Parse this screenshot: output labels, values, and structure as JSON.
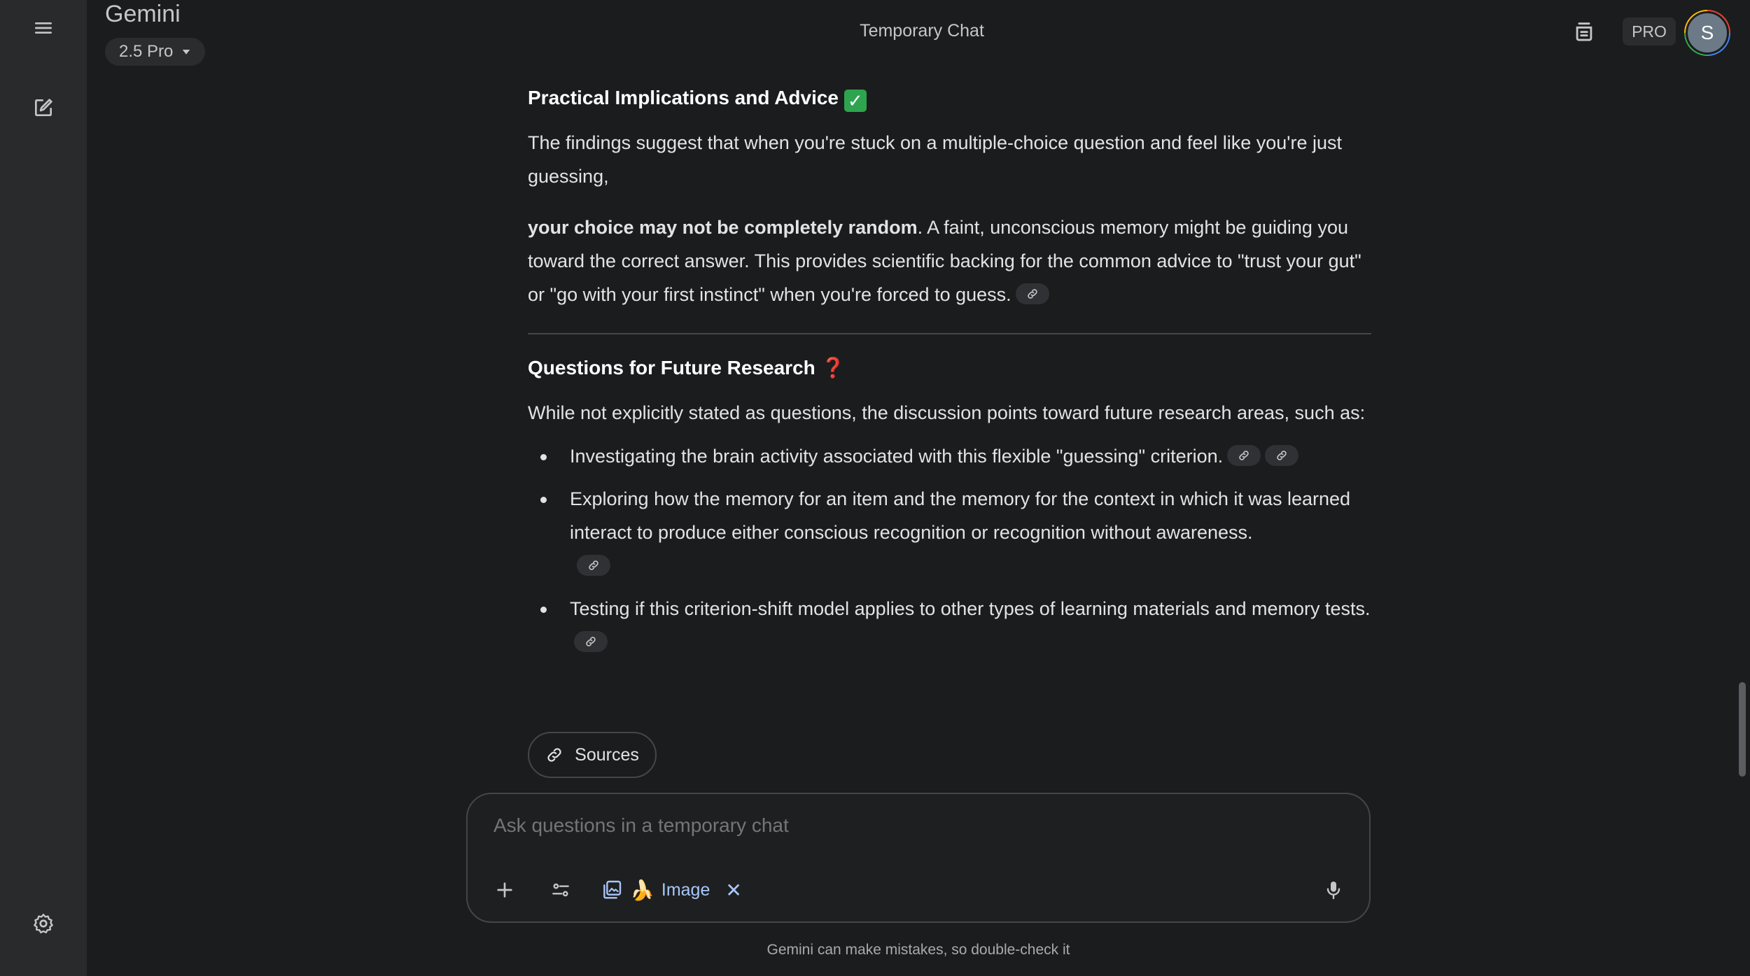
{
  "app": {
    "brand": "Gemini",
    "model": "2.5 Pro",
    "chat_title": "Temporary Chat",
    "pro_badge": "PRO",
    "avatar_initial": "S"
  },
  "sidebar": {
    "icons": [
      "menu-icon",
      "new-chat-icon",
      "settings-icon"
    ]
  },
  "content": {
    "section1": {
      "heading": "Practical Implications and Advice",
      "heading_emoji": "✓",
      "para1": "The findings suggest that when you're stuck on a multiple-choice question and feel like you're just guessing,",
      "para2_bold": "your choice may not be completely random",
      "para2_rest": ". A faint, unconscious memory might be guiding you toward the correct answer. This provides scientific backing for the common advice to \"trust your gut\" or \"go with your first instinct\" when you're forced to guess."
    },
    "section2": {
      "heading": "Questions for Future Research",
      "heading_emoji": "❓",
      "intro": "While not explicitly stated as questions, the discussion points toward future research areas, such as:",
      "bullets": [
        "Investigating the brain activity associated with this flexible \"guessing\" criterion.",
        "Exploring how the memory for an item and the memory for the context in which it was learned interact to produce either conscious recognition or recognition without awareness.",
        "Testing if this criterion-shift model applies to other types of learning materials and memory tests."
      ]
    },
    "sources_label": "Sources"
  },
  "input": {
    "placeholder": "Ask questions in a temporary chat",
    "image_chip_label": "Image",
    "image_chip_emoji": "🍌",
    "close_glyph": "✕"
  },
  "footer": {
    "disclaimer": "Gemini can make mistakes, so double-check it"
  },
  "colors": {
    "background": "#1b1c1d",
    "sidebar": "#282a2c",
    "accent_link": "#a8c7fa",
    "check_green": "#2ea44f",
    "question_red": "#e53935"
  }
}
